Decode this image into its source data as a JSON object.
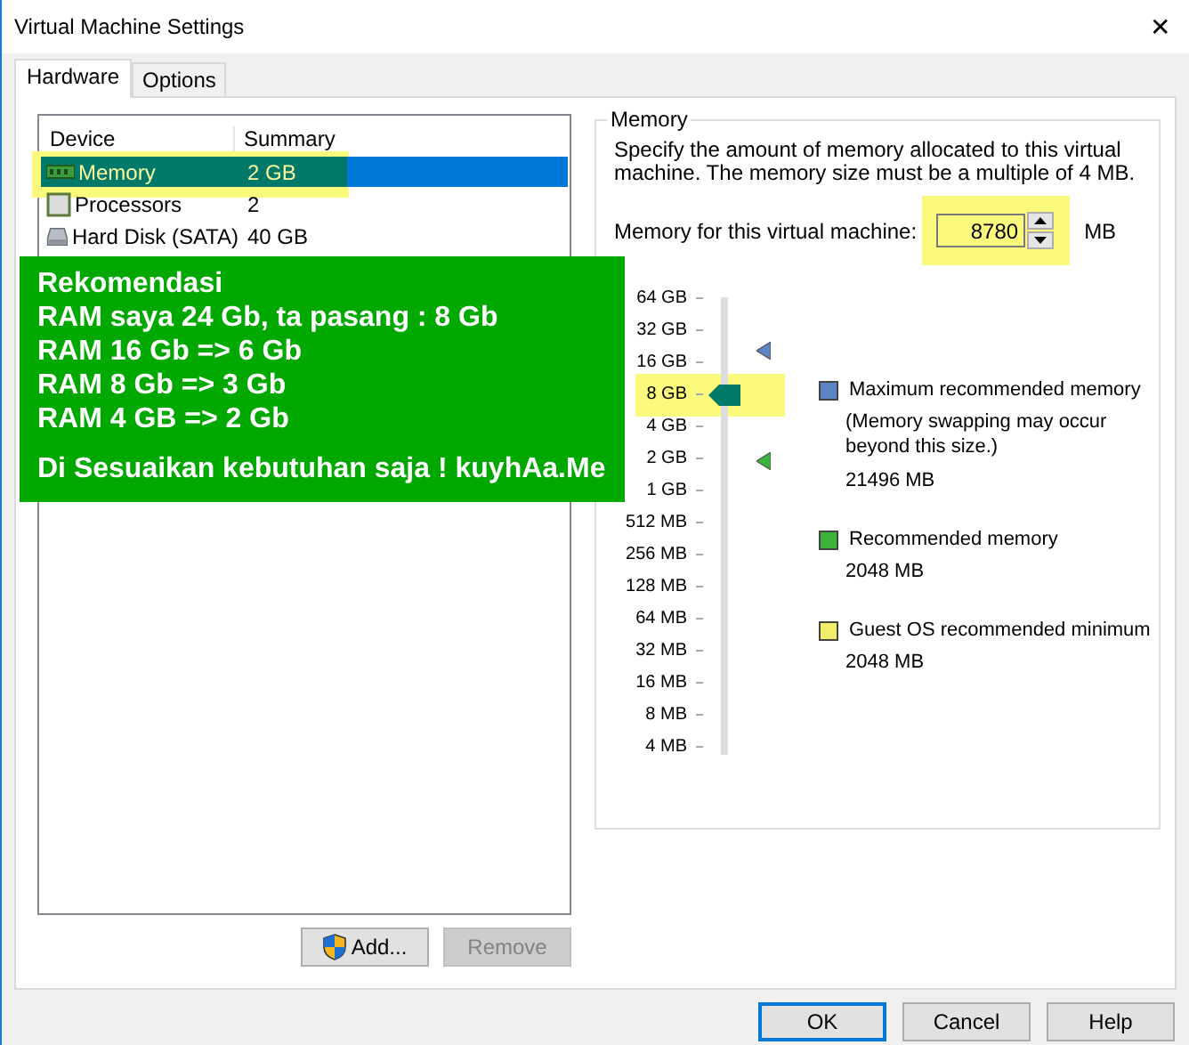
{
  "window": {
    "title": "Virtual Machine Settings",
    "close": "✕"
  },
  "tabs": [
    {
      "label": "Hardware",
      "selected": true
    },
    {
      "label": "Options",
      "selected": false
    }
  ],
  "devices": {
    "columns": [
      "Device",
      "Summary"
    ],
    "rows": [
      {
        "kind": "memory",
        "name": "Memory",
        "summary": "2 GB",
        "selected": true,
        "highlighted": true
      },
      {
        "kind": "cpu",
        "name": "Processors",
        "summary": "2",
        "selected": false,
        "highlighted": false
      },
      {
        "kind": "disk",
        "name": "Hard Disk (SATA)",
        "summary": "40 GB",
        "selected": false,
        "highlighted": false
      }
    ]
  },
  "device_buttons": [
    {
      "label": "Add...",
      "disabled": false,
      "shield": true
    },
    {
      "label": "Remove",
      "disabled": true,
      "shield": false
    }
  ],
  "memory": {
    "title": "Memory",
    "description": "Specify the amount of memory allocated to this virtual machine. The memory size must be a multiple of 4 MB.",
    "field_label": "Memory for this virtual machine:",
    "value": "8780",
    "unit": "MB",
    "field_highlighted": true,
    "scale": [
      {
        "label": "64 GB",
        "highlighted": false
      },
      {
        "label": "32 GB",
        "highlighted": false
      },
      {
        "label": "16 GB",
        "highlighted": false
      },
      {
        "label": "8 GB",
        "highlighted": true
      },
      {
        "label": "4 GB",
        "highlighted": false
      },
      {
        "label": "2 GB",
        "highlighted": false
      },
      {
        "label": "1 GB",
        "highlighted": false
      },
      {
        "label": "512 MB",
        "highlighted": false
      },
      {
        "label": "256 MB",
        "highlighted": false
      },
      {
        "label": "128 MB",
        "highlighted": false
      },
      {
        "label": "64 MB",
        "highlighted": false
      },
      {
        "label": "32 MB",
        "highlighted": false
      },
      {
        "label": "16 MB",
        "highlighted": false
      },
      {
        "label": "8 MB",
        "highlighted": false
      },
      {
        "label": "4 MB",
        "highlighted": false
      }
    ],
    "level": 0.786,
    "markers": [
      {
        "color": "#5b84c4",
        "level": 0.885
      },
      {
        "color": "#3cb43c",
        "level": 0.643
      }
    ],
    "legend": [
      {
        "color": "#5b84c4",
        "label": "Maximum recommended memory",
        "note": "(Memory swapping may occur beyond this size.)",
        "value": "21496 MB"
      },
      {
        "color": "#3cb43c",
        "label": "Recommended memory",
        "value": "2048 MB"
      },
      {
        "color": "#f2ee6a",
        "label": "Guest OS recommended minimum",
        "value": "2048 MB"
      }
    ]
  },
  "note": {
    "lines": [
      "Rekomendasi",
      "RAM saya 24 Gb, ta pasang : 8 Gb",
      "RAM 16 Gb => 6 Gb",
      "RAM 8 Gb => 3 Gb",
      "RAM 4 GB => 2 Gb"
    ],
    "footer": "Di Sesuaikan kebutuhan saja ! kuyhAa.Me"
  },
  "dialog_buttons": [
    {
      "label": "OK",
      "default": true
    },
    {
      "label": "Cancel",
      "default": false
    },
    {
      "label": "Help",
      "default": false
    }
  ]
}
